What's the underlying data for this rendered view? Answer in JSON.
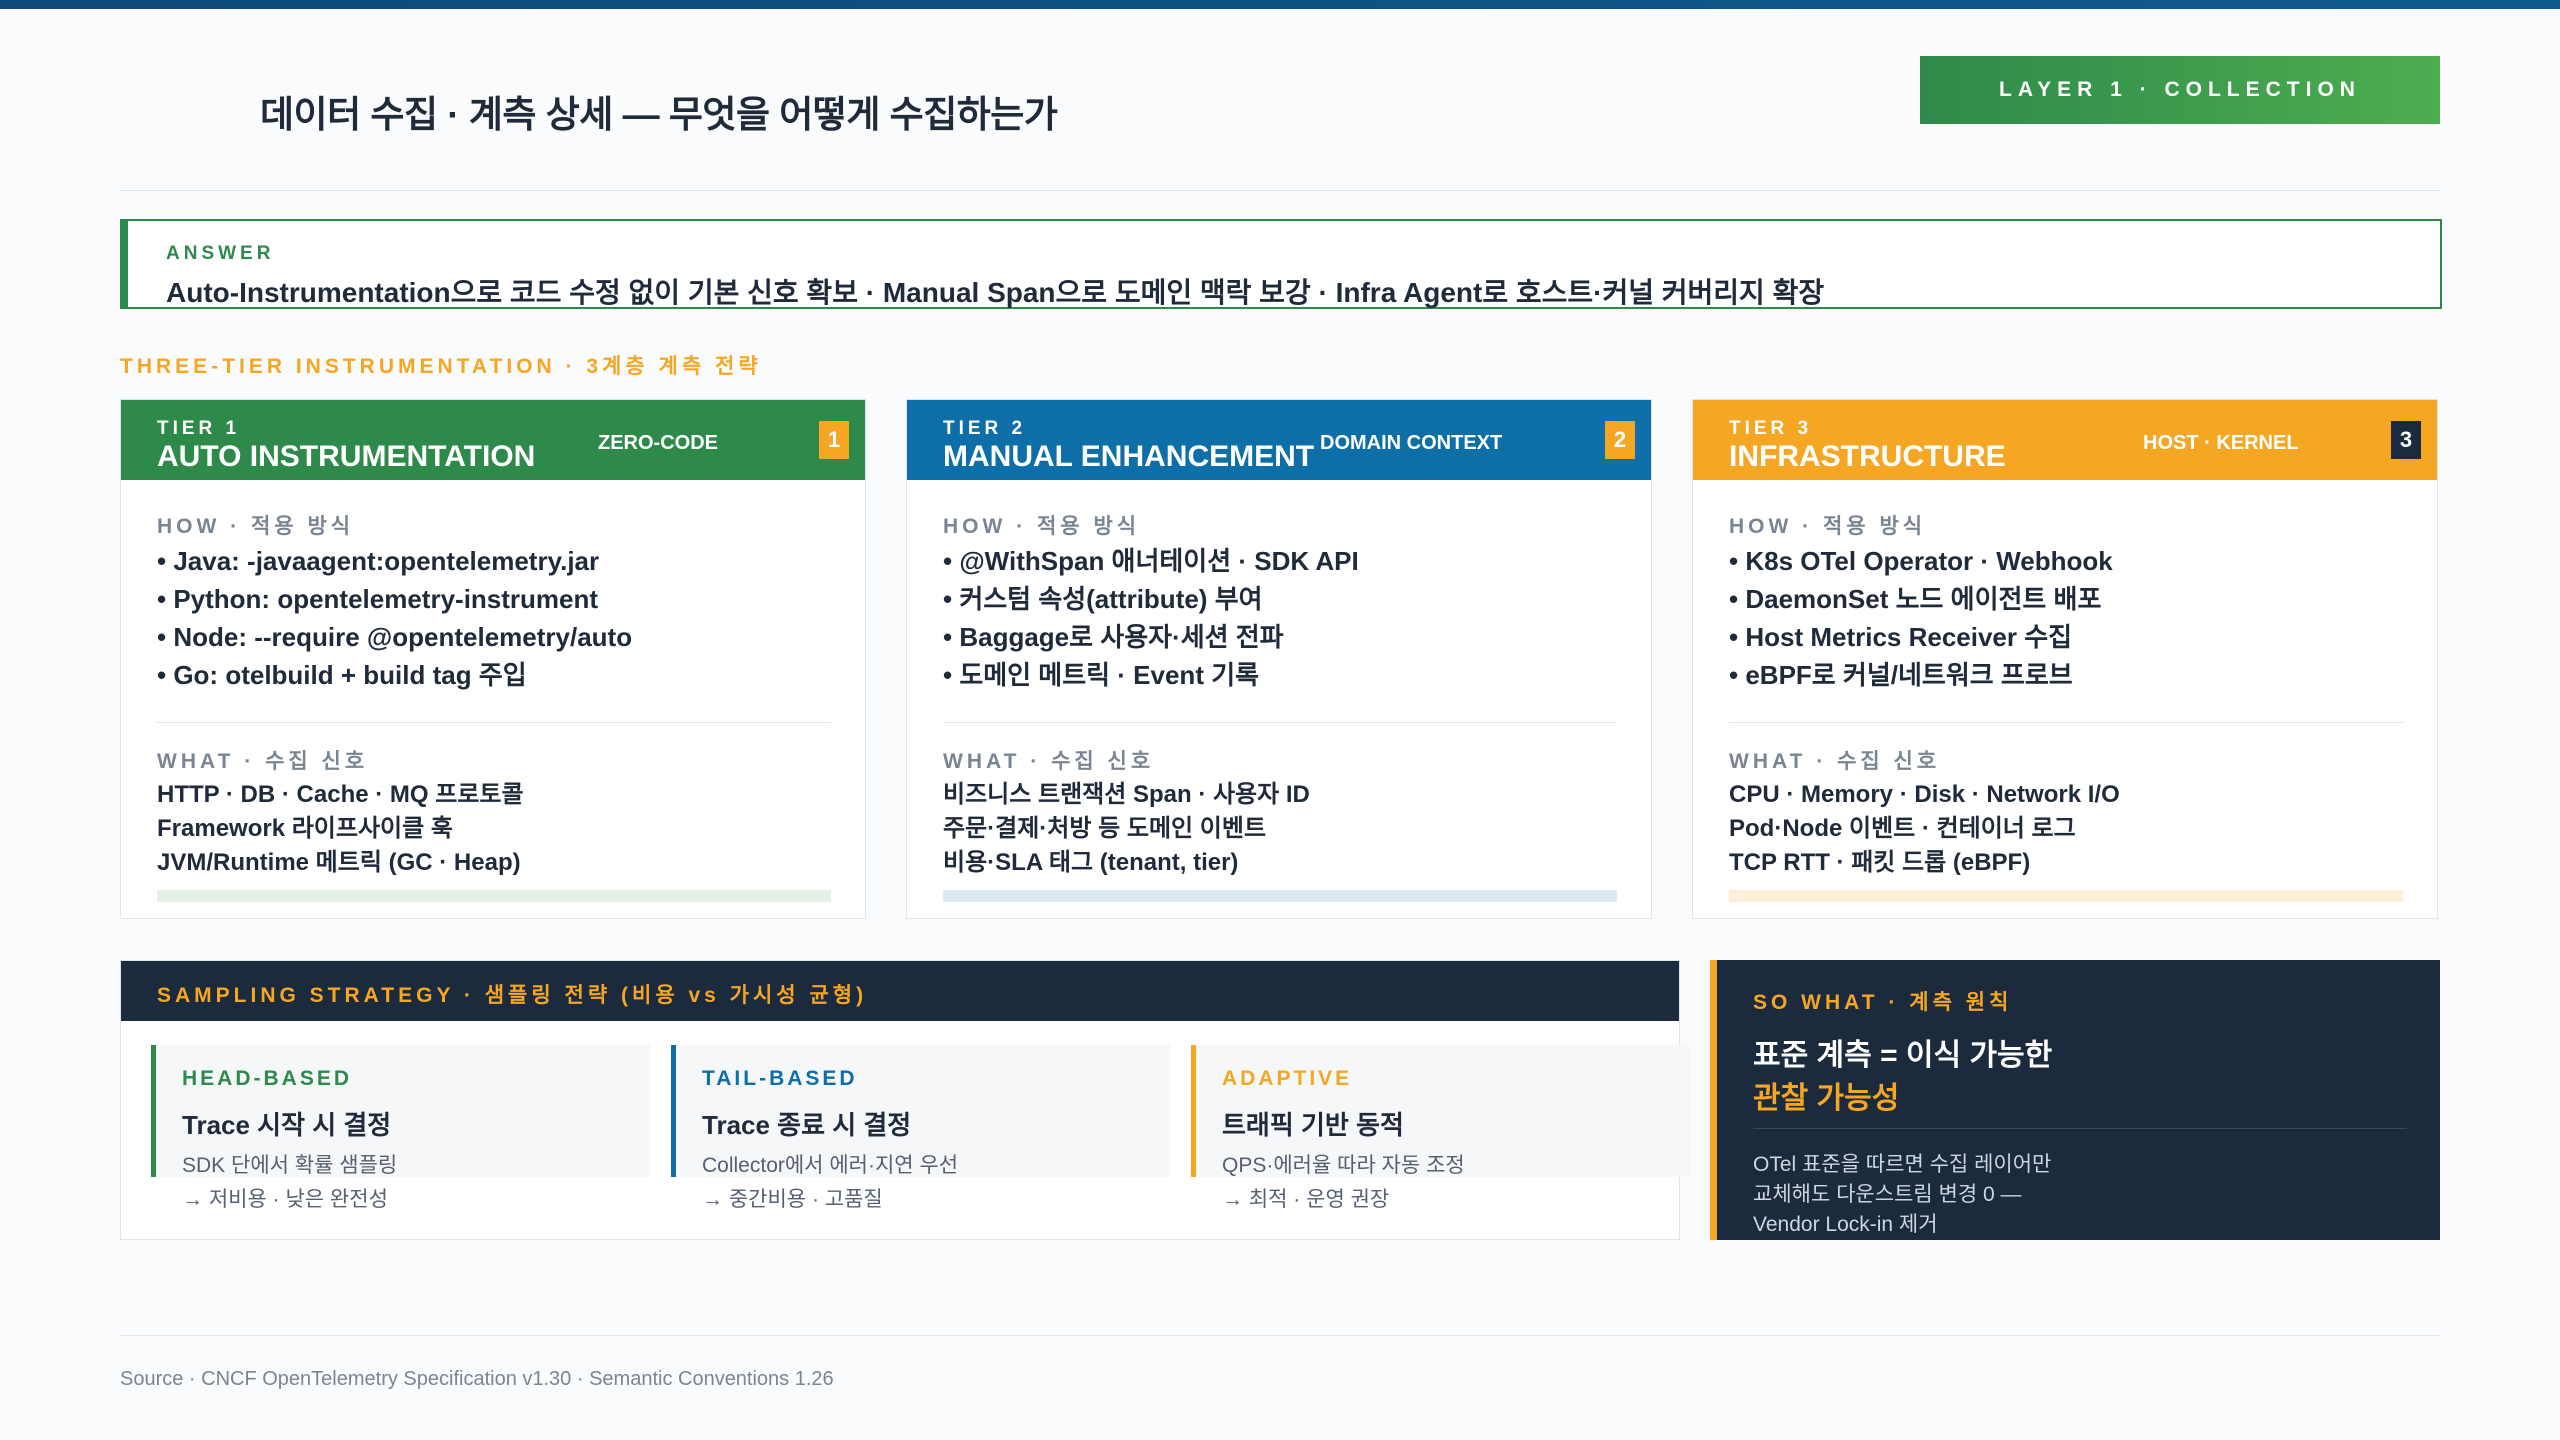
{
  "title": "데이터 수집 · 계측 상세 — 무엇을 어떻게 수집하는가",
  "layer_badge": "LAYER 1 · COLLECTION",
  "answer": {
    "label": "ANSWER",
    "text": "Auto-Instrumentation으로 코드 수정 없이 기본 신호 확보 · Manual Span으로 도메인 맥락 보강 · Infra Agent로 호스트·커널 커버리지 확장"
  },
  "section_label": "THREE-TIER INSTRUMENTATION · 3계층 계측 전략",
  "tiers": [
    {
      "label": "TIER 1",
      "name": "AUTO INSTRUMENTATION",
      "tag": "ZERO-CODE",
      "num": "1",
      "color": "#2d8a4a",
      "how_header": "HOW · 적용 방식",
      "how": [
        "• Java: -javaagent:opentelemetry.jar",
        "• Python: opentelemetry-instrument",
        "• Node: --require @opentelemetry/auto",
        "• Go: otelbuild + build tag 주입"
      ],
      "what_header": "WHAT · 수집 신호",
      "what": [
        "HTTP · DB · Cache · MQ 프로토콜",
        "Framework 라이프사이클 훅",
        "JVM/Runtime 메트릭 (GC · Heap)"
      ]
    },
    {
      "label": "TIER 2",
      "name": "MANUAL ENHANCEMENT",
      "tag": "DOMAIN CONTEXT",
      "num": "2",
      "color": "#0d6ea8",
      "how_header": "HOW · 적용 방식",
      "how": [
        "• @WithSpan 애너테이션 · SDK API",
        "• 커스텀 속성(attribute) 부여",
        "• Baggage로 사용자·세션 전파",
        "• 도메인 메트릭 · Event 기록"
      ],
      "what_header": "WHAT · 수집 신호",
      "what": [
        "비즈니스 트랜잭션 Span · 사용자 ID",
        "주문·결제·처방 등 도메인 이벤트",
        "비용·SLA 태그 (tenant, tier)"
      ]
    },
    {
      "label": "TIER 3",
      "name": "INFRASTRUCTURE",
      "tag": "HOST · KERNEL",
      "num": "3",
      "color": "#f5a623",
      "how_header": "HOW · 적용 방식",
      "how": [
        "• K8s OTel Operator · Webhook",
        "• DaemonSet 노드 에이전트 배포",
        "• Host Metrics Receiver 수집",
        "• eBPF로 커널/네트워크 프로브"
      ],
      "what_header": "WHAT · 수집 신호",
      "what": [
        "CPU · Memory · Disk · Network I/O",
        "Pod·Node 이벤트 · 컨테이너 로그",
        "TCP RTT · 패킷 드롭 (eBPF)"
      ]
    }
  ],
  "sampling": {
    "title": "SAMPLING STRATEGY · 샘플링 전략 (비용 vs 가시성 균형)",
    "cards": [
      {
        "label": "HEAD-BASED",
        "title": "Trace 시작 시 결정",
        "desc1": "SDK 단에서 확률 샘플링",
        "desc2": "→ 저비용 · 낮은 완전성",
        "color": "#2d8a4a"
      },
      {
        "label": "TAIL-BASED",
        "title": "Trace 종료 시 결정",
        "desc1": "Collector에서 에러·지연 우선",
        "desc2": "→ 중간비용 · 고품질",
        "color": "#0d6ea8"
      },
      {
        "label": "ADAPTIVE",
        "title": "트래픽 기반 동적",
        "desc1": "QPS·에러율 따라 자동 조정",
        "desc2": "→ 최적 · 운영 권장",
        "color": "#f5a623"
      }
    ]
  },
  "so_what": {
    "label": "SO WHAT · 계측 원칙",
    "title_line1": "표준 계측 = 이식 가능한",
    "title_line2": "관찰 가능성",
    "body": [
      "OTel 표준을 따르면 수집 레이어만",
      "교체해도 다운스트림 변경 0 —",
      "Vendor Lock-in 제거"
    ]
  },
  "source": "Source · CNCF OpenTelemetry Specification v1.30 · Semantic Conventions 1.26"
}
